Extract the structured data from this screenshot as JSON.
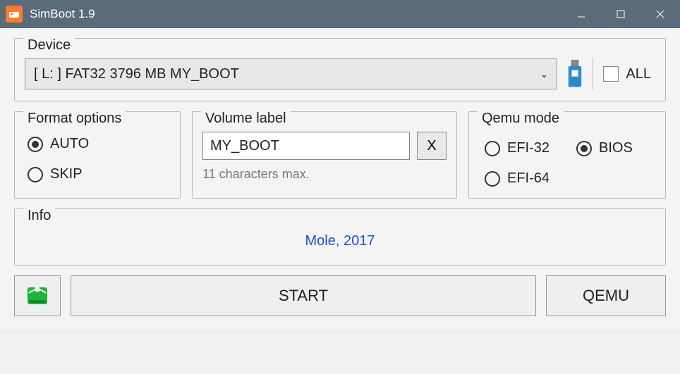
{
  "title": "SimBoot 1.9",
  "device": {
    "group_label": "Device",
    "selected": "[ L: ]   FAT32   3796 MB   MY_BOOT",
    "all_label": "ALL",
    "all_checked": false
  },
  "format": {
    "group_label": "Format options",
    "options": [
      {
        "label": "AUTO",
        "selected": true
      },
      {
        "label": "SKIP",
        "selected": false
      }
    ]
  },
  "volume": {
    "group_label": "Volume label",
    "value": "MY_BOOT",
    "clear_label": "X",
    "hint": "11 characters max."
  },
  "qemu": {
    "group_label": "Qemu mode",
    "options": [
      {
        "label": "EFI-32",
        "selected": false
      },
      {
        "label": "EFI-64",
        "selected": false
      },
      {
        "label": "BIOS",
        "selected": true
      }
    ]
  },
  "info": {
    "group_label": "Info",
    "text": "Mole, 2017"
  },
  "buttons": {
    "start": "START",
    "qemu": "QEMU"
  }
}
